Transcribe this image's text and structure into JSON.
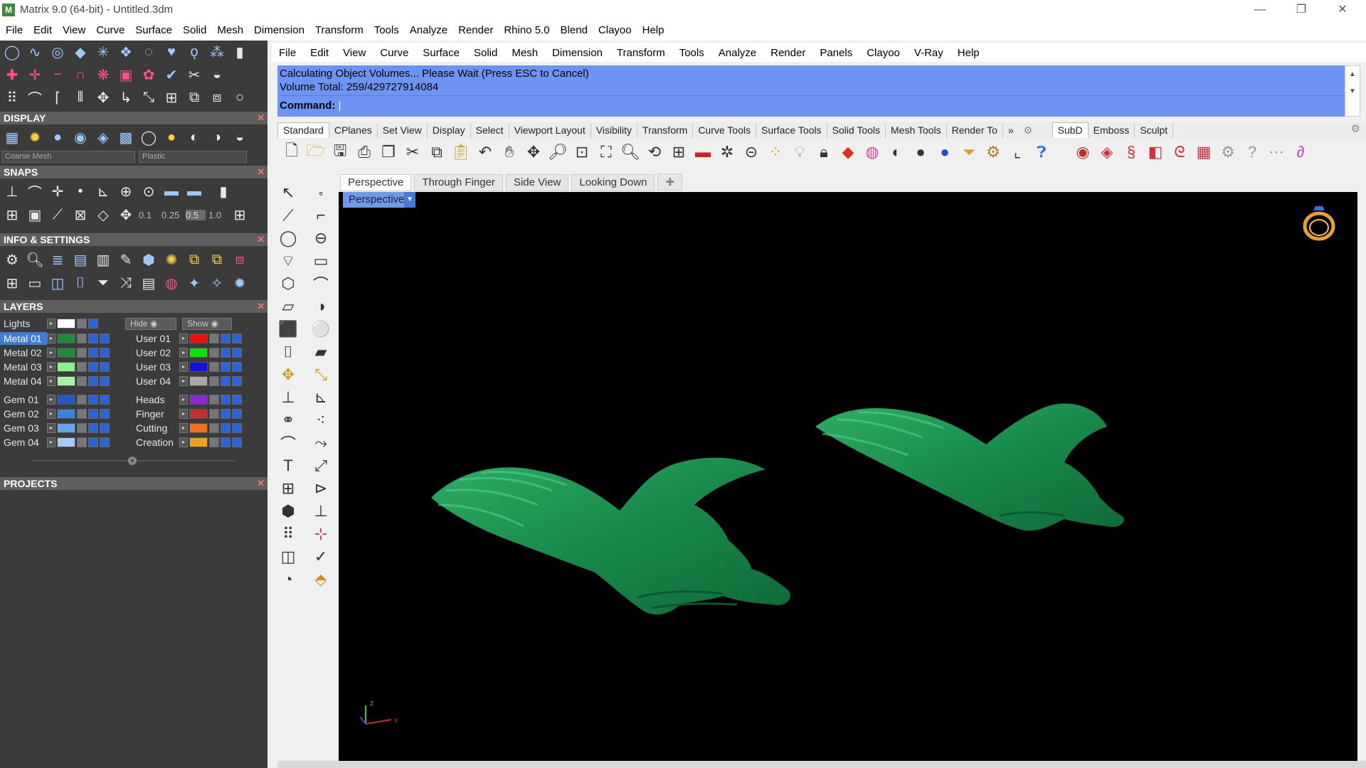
{
  "window": {
    "title": "Matrix 9.0 (64-bit) - Untitled.3dm"
  },
  "outer_menu": [
    "File",
    "Edit",
    "View",
    "Curve",
    "Surface",
    "Solid",
    "Mesh",
    "Dimension",
    "Transform",
    "Tools",
    "Analyze",
    "Render",
    "Rhino 5.0",
    "Blend",
    "Clayoo",
    "Help"
  ],
  "left_panel": {
    "display": {
      "title": "DISPLAY",
      "mesh_quality": "Coarse Mesh",
      "material": "Plastic"
    },
    "snaps": {
      "title": "SNAPS",
      "values": [
        "0.1",
        "0.25",
        "0.5",
        "1.0"
      ]
    },
    "info": {
      "title": "INFO & SETTINGS"
    },
    "layers": {
      "title": "LAYERS",
      "lights": "Lights",
      "hide": "Hide",
      "show": "Show",
      "left_col": [
        {
          "name": "Metal 01",
          "color": "#1e8a3a",
          "selected": true
        },
        {
          "name": "Metal 02",
          "color": "#1e8a3a",
          "selected": false
        },
        {
          "name": "Metal 03",
          "color": "#8af08a",
          "selected": false
        },
        {
          "name": "Metal 04",
          "color": "#a6f2a6",
          "selected": false
        },
        {
          "name": "Gem 01",
          "color": "#1f5ac8",
          "selected": false
        },
        {
          "name": "Gem 02",
          "color": "#3c82e0",
          "selected": false
        },
        {
          "name": "Gem 03",
          "color": "#6aa3ee",
          "selected": false
        },
        {
          "name": "Gem 04",
          "color": "#a8c8f6",
          "selected": false
        }
      ],
      "right_col": [
        {
          "name": "User 01",
          "color": "#f01010"
        },
        {
          "name": "User 02",
          "color": "#10e010"
        },
        {
          "name": "User 03",
          "color": "#1010e0"
        },
        {
          "name": "User 04",
          "color": "#a8a8a8"
        },
        {
          "name": "Heads",
          "color": "#8a2ad0"
        },
        {
          "name": "Finger",
          "color": "#c03030"
        },
        {
          "name": "Cutting",
          "color": "#f07020"
        },
        {
          "name": "Creation",
          "color": "#f0a020"
        }
      ]
    },
    "projects": {
      "title": "PROJECTS"
    }
  },
  "inner_menu": [
    "File",
    "Edit",
    "View",
    "Curve",
    "Surface",
    "Solid",
    "Mesh",
    "Dimension",
    "Transform",
    "Tools",
    "Analyze",
    "Render",
    "Panels",
    "Clayoo",
    "V-Ray",
    "Help"
  ],
  "command": {
    "line1": "Calculating Object Volumes... Please Wait (Press ESC to Cancel)",
    "line2": "Volume Total: 259/429727914084",
    "prompt": "Command:"
  },
  "toolbar_tabs": [
    "Standard",
    "CPlanes",
    "Set View",
    "Display",
    "Select",
    "Viewport Layout",
    "Visibility",
    "Transform",
    "Curve Tools",
    "Surface Tools",
    "Solid Tools",
    "Mesh Tools",
    "Render To"
  ],
  "right_tabs": [
    "SubD",
    "Emboss",
    "Sculpt"
  ],
  "viewport_tabs": [
    "Perspective",
    "Through Finger",
    "Side View",
    "Looking Down"
  ],
  "viewport_label": "Perspective",
  "axis": {
    "z": "z",
    "x": "x"
  },
  "colors": {
    "accent": "#6d94f3",
    "model": "#1f8a4a",
    "panel": "#3b3b3b"
  }
}
